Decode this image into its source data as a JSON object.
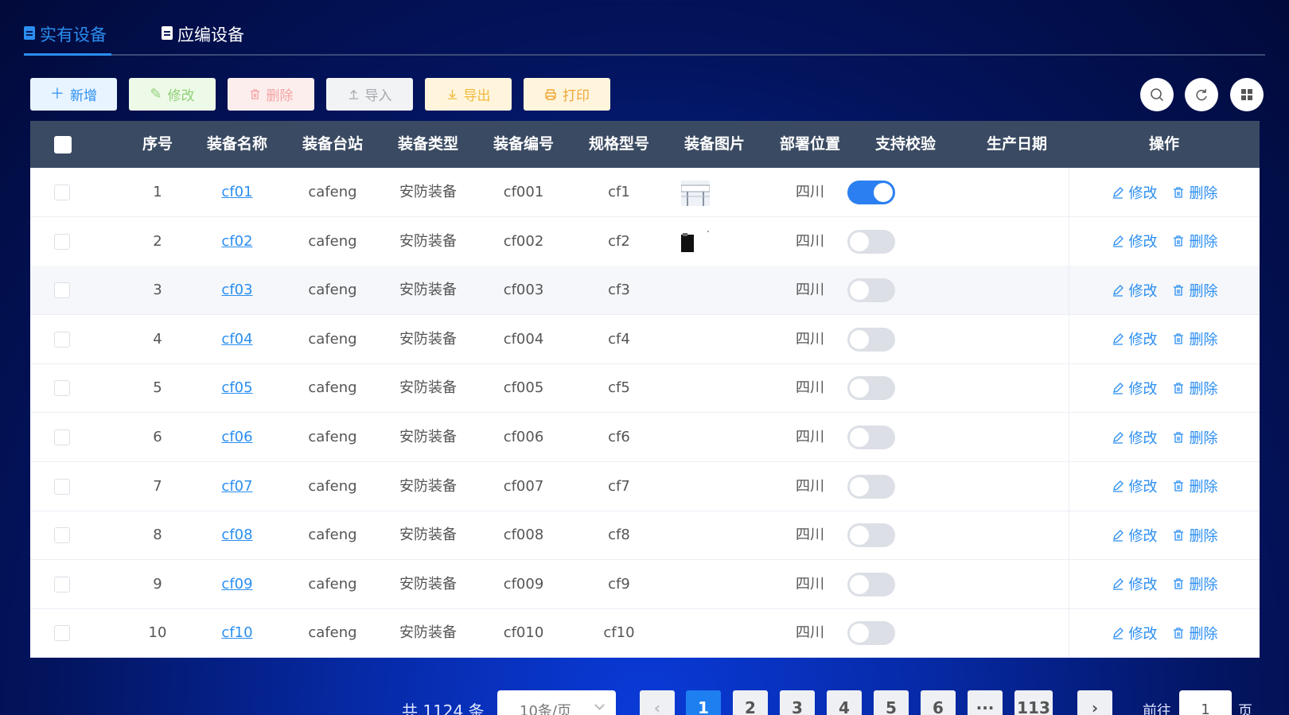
{
  "tabs": [
    {
      "label": "实有设备",
      "active": true
    },
    {
      "label": "应编设备",
      "active": false
    }
  ],
  "toolbar": {
    "add": "新增",
    "edit": "修改",
    "delete": "删除",
    "import": "导入",
    "export": "导出",
    "print": "打印"
  },
  "table": {
    "headers": [
      "序号",
      "装备名称",
      "装备台站",
      "装备类型",
      "装备编号",
      "规格型号",
      "装备图片",
      "部署位置",
      "支持校验",
      "生产日期",
      "操作"
    ],
    "rows": [
      {
        "idx": "1",
        "name": "cf01",
        "station": "cafeng",
        "type": "安防装备",
        "code": "cf001",
        "model": "cf1",
        "image": "photo",
        "location": "四川",
        "verify": true,
        "date": ""
      },
      {
        "idx": "2",
        "name": "cf02",
        "station": "cafeng",
        "type": "安防装备",
        "code": "cf002",
        "model": "cf2",
        "image": "photo-dark",
        "location": "四川",
        "verify": false,
        "date": ""
      },
      {
        "idx": "3",
        "name": "cf03",
        "station": "cafeng",
        "type": "安防装备",
        "code": "cf003",
        "model": "cf3",
        "image": "",
        "location": "四川",
        "verify": false,
        "date": ""
      },
      {
        "idx": "4",
        "name": "cf04",
        "station": "cafeng",
        "type": "安防装备",
        "code": "cf004",
        "model": "cf4",
        "image": "",
        "location": "四川",
        "verify": false,
        "date": ""
      },
      {
        "idx": "5",
        "name": "cf05",
        "station": "cafeng",
        "type": "安防装备",
        "code": "cf005",
        "model": "cf5",
        "image": "",
        "location": "四川",
        "verify": false,
        "date": ""
      },
      {
        "idx": "6",
        "name": "cf06",
        "station": "cafeng",
        "type": "安防装备",
        "code": "cf006",
        "model": "cf6",
        "image": "",
        "location": "四川",
        "verify": false,
        "date": ""
      },
      {
        "idx": "7",
        "name": "cf07",
        "station": "cafeng",
        "type": "安防装备",
        "code": "cf007",
        "model": "cf7",
        "image": "",
        "location": "四川",
        "verify": false,
        "date": ""
      },
      {
        "idx": "8",
        "name": "cf08",
        "station": "cafeng",
        "type": "安防装备",
        "code": "cf008",
        "model": "cf8",
        "image": "",
        "location": "四川",
        "verify": false,
        "date": ""
      },
      {
        "idx": "9",
        "name": "cf09",
        "station": "cafeng",
        "type": "安防装备",
        "code": "cf009",
        "model": "cf9",
        "image": "",
        "location": "四川",
        "verify": false,
        "date": ""
      },
      {
        "idx": "10",
        "name": "cf10",
        "station": "cafeng",
        "type": "安防装备",
        "code": "cf010",
        "model": "cf10",
        "image": "",
        "location": "四川",
        "verify": false,
        "date": ""
      }
    ],
    "row_actions": {
      "edit": "修改",
      "delete": "删除"
    }
  },
  "pagination": {
    "total_text": "共 1124 条",
    "page_size": "10条/页",
    "pages": [
      "1",
      "2",
      "3",
      "4",
      "5",
      "6",
      "···",
      "113"
    ],
    "current": "1",
    "goto_label": "前往",
    "goto_value": "1",
    "page_unit": "页"
  },
  "colors": {
    "accent": "#2b8ef0",
    "header_bg": "#3a4a62",
    "switch_on": "#2b7ff0"
  }
}
